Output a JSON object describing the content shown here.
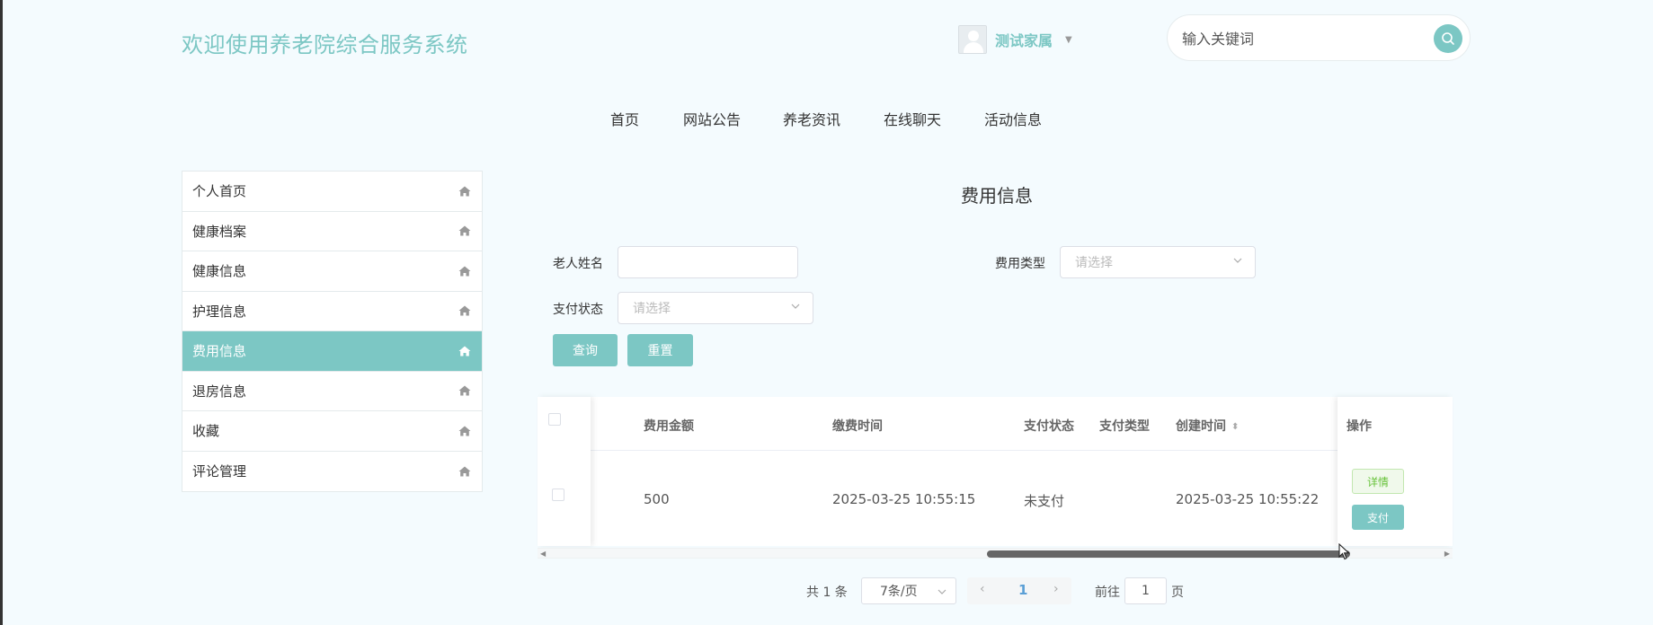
{
  "header": {
    "title": "欢迎使用养老院综合服务系统",
    "user_name": "测试家属",
    "search_placeholder": "输入关键词"
  },
  "nav": [
    "首页",
    "网站公告",
    "养老资讯",
    "在线聊天",
    "活动信息"
  ],
  "sidebar": {
    "items": [
      {
        "label": "个人首页",
        "active": false
      },
      {
        "label": "健康档案",
        "active": false
      },
      {
        "label": "健康信息",
        "active": false
      },
      {
        "label": "护理信息",
        "active": false
      },
      {
        "label": "费用信息",
        "active": true
      },
      {
        "label": "退房信息",
        "active": false
      },
      {
        "label": "收藏",
        "active": false
      },
      {
        "label": "评论管理",
        "active": false
      }
    ]
  },
  "main": {
    "title": "费用信息",
    "filters": {
      "name_label": "老人姓名",
      "name_value": "",
      "type_label": "费用类型",
      "type_placeholder": "请选择",
      "status_label": "支付状态",
      "status_placeholder": "请选择"
    },
    "buttons": {
      "search": "查询",
      "reset": "重置"
    },
    "table": {
      "headers": {
        "amount": "费用金额",
        "pay_time": "缴费时间",
        "status": "支付状态",
        "type": "支付类型",
        "created": "创建时间",
        "action": "操作"
      },
      "rows": [
        {
          "amount": "500",
          "pay_time": "2025-03-25 10:55:15",
          "status": "未支付",
          "type": "",
          "created": "2025-03-25 10:55:22",
          "detail_btn": "详情",
          "pay_btn": "支付"
        }
      ]
    },
    "pagination": {
      "total": "共 1 条",
      "page_size": "7条/页",
      "current": "1",
      "goto_label": "前往",
      "goto_value": "1",
      "page_unit": "页"
    }
  },
  "colors": {
    "accent": "#7cc7c4",
    "background": "#f4fbfe"
  }
}
